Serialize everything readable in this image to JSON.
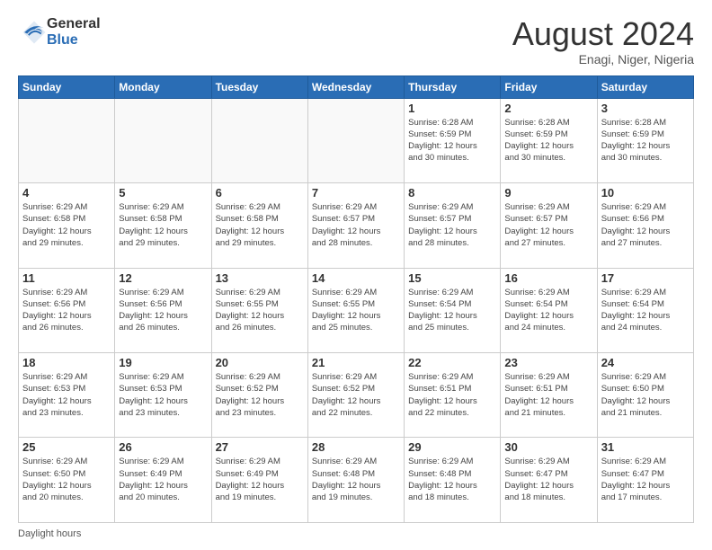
{
  "logo": {
    "general": "General",
    "blue": "Blue"
  },
  "title": {
    "month": "August 2024",
    "location": "Enagi, Niger, Nigeria"
  },
  "days_header": [
    "Sunday",
    "Monday",
    "Tuesday",
    "Wednesday",
    "Thursday",
    "Friday",
    "Saturday"
  ],
  "weeks": [
    [
      {
        "day": "",
        "info": ""
      },
      {
        "day": "",
        "info": ""
      },
      {
        "day": "",
        "info": ""
      },
      {
        "day": "",
        "info": ""
      },
      {
        "day": "1",
        "info": "Sunrise: 6:28 AM\nSunset: 6:59 PM\nDaylight: 12 hours\nand 30 minutes."
      },
      {
        "day": "2",
        "info": "Sunrise: 6:28 AM\nSunset: 6:59 PM\nDaylight: 12 hours\nand 30 minutes."
      },
      {
        "day": "3",
        "info": "Sunrise: 6:28 AM\nSunset: 6:59 PM\nDaylight: 12 hours\nand 30 minutes."
      }
    ],
    [
      {
        "day": "4",
        "info": "Sunrise: 6:29 AM\nSunset: 6:58 PM\nDaylight: 12 hours\nand 29 minutes."
      },
      {
        "day": "5",
        "info": "Sunrise: 6:29 AM\nSunset: 6:58 PM\nDaylight: 12 hours\nand 29 minutes."
      },
      {
        "day": "6",
        "info": "Sunrise: 6:29 AM\nSunset: 6:58 PM\nDaylight: 12 hours\nand 29 minutes."
      },
      {
        "day": "7",
        "info": "Sunrise: 6:29 AM\nSunset: 6:57 PM\nDaylight: 12 hours\nand 28 minutes."
      },
      {
        "day": "8",
        "info": "Sunrise: 6:29 AM\nSunset: 6:57 PM\nDaylight: 12 hours\nand 28 minutes."
      },
      {
        "day": "9",
        "info": "Sunrise: 6:29 AM\nSunset: 6:57 PM\nDaylight: 12 hours\nand 27 minutes."
      },
      {
        "day": "10",
        "info": "Sunrise: 6:29 AM\nSunset: 6:56 PM\nDaylight: 12 hours\nand 27 minutes."
      }
    ],
    [
      {
        "day": "11",
        "info": "Sunrise: 6:29 AM\nSunset: 6:56 PM\nDaylight: 12 hours\nand 26 minutes."
      },
      {
        "day": "12",
        "info": "Sunrise: 6:29 AM\nSunset: 6:56 PM\nDaylight: 12 hours\nand 26 minutes."
      },
      {
        "day": "13",
        "info": "Sunrise: 6:29 AM\nSunset: 6:55 PM\nDaylight: 12 hours\nand 26 minutes."
      },
      {
        "day": "14",
        "info": "Sunrise: 6:29 AM\nSunset: 6:55 PM\nDaylight: 12 hours\nand 25 minutes."
      },
      {
        "day": "15",
        "info": "Sunrise: 6:29 AM\nSunset: 6:54 PM\nDaylight: 12 hours\nand 25 minutes."
      },
      {
        "day": "16",
        "info": "Sunrise: 6:29 AM\nSunset: 6:54 PM\nDaylight: 12 hours\nand 24 minutes."
      },
      {
        "day": "17",
        "info": "Sunrise: 6:29 AM\nSunset: 6:54 PM\nDaylight: 12 hours\nand 24 minutes."
      }
    ],
    [
      {
        "day": "18",
        "info": "Sunrise: 6:29 AM\nSunset: 6:53 PM\nDaylight: 12 hours\nand 23 minutes."
      },
      {
        "day": "19",
        "info": "Sunrise: 6:29 AM\nSunset: 6:53 PM\nDaylight: 12 hours\nand 23 minutes."
      },
      {
        "day": "20",
        "info": "Sunrise: 6:29 AM\nSunset: 6:52 PM\nDaylight: 12 hours\nand 23 minutes."
      },
      {
        "day": "21",
        "info": "Sunrise: 6:29 AM\nSunset: 6:52 PM\nDaylight: 12 hours\nand 22 minutes."
      },
      {
        "day": "22",
        "info": "Sunrise: 6:29 AM\nSunset: 6:51 PM\nDaylight: 12 hours\nand 22 minutes."
      },
      {
        "day": "23",
        "info": "Sunrise: 6:29 AM\nSunset: 6:51 PM\nDaylight: 12 hours\nand 21 minutes."
      },
      {
        "day": "24",
        "info": "Sunrise: 6:29 AM\nSunset: 6:50 PM\nDaylight: 12 hours\nand 21 minutes."
      }
    ],
    [
      {
        "day": "25",
        "info": "Sunrise: 6:29 AM\nSunset: 6:50 PM\nDaylight: 12 hours\nand 20 minutes."
      },
      {
        "day": "26",
        "info": "Sunrise: 6:29 AM\nSunset: 6:49 PM\nDaylight: 12 hours\nand 20 minutes."
      },
      {
        "day": "27",
        "info": "Sunrise: 6:29 AM\nSunset: 6:49 PM\nDaylight: 12 hours\nand 19 minutes."
      },
      {
        "day": "28",
        "info": "Sunrise: 6:29 AM\nSunset: 6:48 PM\nDaylight: 12 hours\nand 19 minutes."
      },
      {
        "day": "29",
        "info": "Sunrise: 6:29 AM\nSunset: 6:48 PM\nDaylight: 12 hours\nand 18 minutes."
      },
      {
        "day": "30",
        "info": "Sunrise: 6:29 AM\nSunset: 6:47 PM\nDaylight: 12 hours\nand 18 minutes."
      },
      {
        "day": "31",
        "info": "Sunrise: 6:29 AM\nSunset: 6:47 PM\nDaylight: 12 hours\nand 17 minutes."
      }
    ]
  ],
  "footer": {
    "daylight_label": "Daylight hours"
  }
}
